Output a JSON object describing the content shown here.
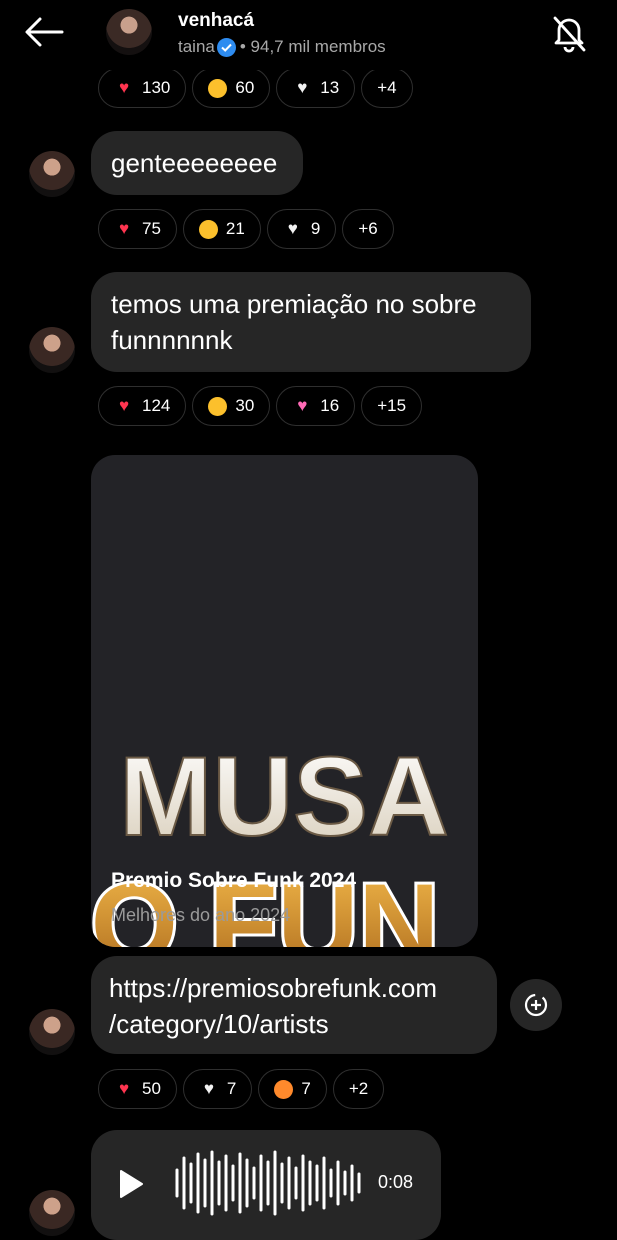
{
  "header": {
    "title": "venhacá",
    "owner": "taina",
    "members": "• 94,7 mil membros"
  },
  "reactions_top": [
    {
      "emoji": "heart",
      "count": "130"
    },
    {
      "emoji": "joy",
      "count": "60"
    },
    {
      "emoji": "white-heart",
      "count": "13"
    },
    {
      "emoji": "",
      "count": "+4"
    }
  ],
  "messages": [
    {
      "text": "genteeeeeeee",
      "reactions": [
        {
          "emoji": "heart",
          "count": "75"
        },
        {
          "emoji": "open-mouth",
          "count": "21"
        },
        {
          "emoji": "white-heart",
          "count": "9"
        },
        {
          "emoji": "",
          "count": "+6"
        }
      ]
    },
    {
      "line1": "temos uma premiação no sobre",
      "line2": "funnnnnnk",
      "reactions": [
        {
          "emoji": "heart",
          "count": "124"
        },
        {
          "emoji": "open-mouth",
          "count": "30"
        },
        {
          "emoji": "two-hearts",
          "count": "16"
        },
        {
          "emoji": "",
          "count": "+15"
        }
      ]
    }
  ],
  "link_card": {
    "image_text_1": "MUSA",
    "image_text_2": "O FUN",
    "title": "Premio Sobre Funk 2024",
    "subtitle": "Melhores do ano 2024"
  },
  "link_message": {
    "line1": "https://premiosobrefunk.com",
    "line2": "/category/10/artists",
    "reactions": [
      {
        "emoji": "heart",
        "count": "50"
      },
      {
        "emoji": "white-heart",
        "count": "7"
      },
      {
        "emoji": "heart-eyes",
        "count": "7"
      },
      {
        "emoji": "",
        "count": "+2"
      }
    ]
  },
  "audio": {
    "duration": "0:08"
  },
  "colors": {
    "background": "#000000",
    "bubble": "#262626",
    "verified": "#2e8cf0",
    "heart": "#ff3550"
  }
}
